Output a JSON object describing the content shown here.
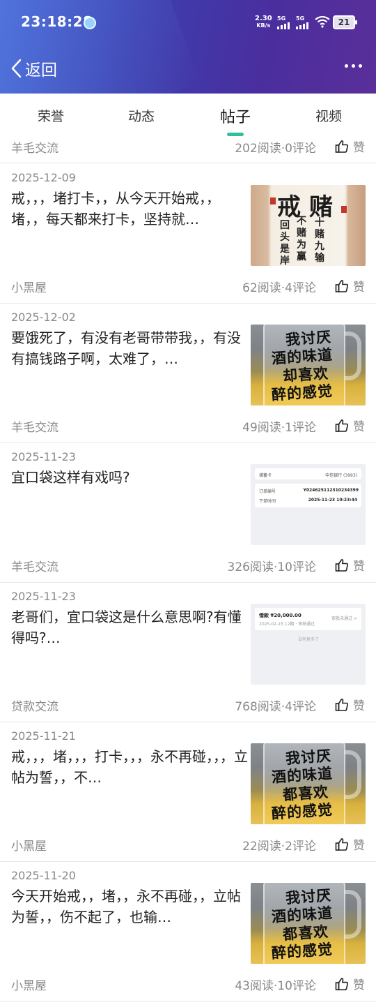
{
  "status_bar": {
    "time": "23:18:28",
    "net_speed_value": "2.30",
    "net_speed_unit": "KB/s",
    "sim1_label": "5G",
    "sim2_label": "5G",
    "battery_level": "21"
  },
  "nav": {
    "back_label": "返回"
  },
  "tabs": [
    {
      "label": "荣誉",
      "active": false
    },
    {
      "label": "动态",
      "active": false
    },
    {
      "label": "帖子",
      "active": true
    },
    {
      "label": "视频",
      "active": false
    }
  ],
  "partial_item": {
    "category": "羊毛交流",
    "stats": "202阅读·0评论",
    "like_label": "赞"
  },
  "posts": [
    {
      "date": "2025-12-09",
      "text": "戒，，，堵打卡，，从今天开始戒，，堵，，每天都来打卡，坚持就…",
      "thumb_type": "calligraphy",
      "thumb_text": {
        "big1": "戒",
        "big2": "赌",
        "col1": "回头是岸",
        "col2": "不赌为赢",
        "col3": "十赌九输"
      },
      "category": "小黑屋",
      "stats": "62阅读·4评论",
      "like_label": "赞"
    },
    {
      "date": "2025-12-02",
      "text": "要饿死了，有没有老哥带带我，，有没有搞钱路子啊，太难了，…",
      "thumb_type": "beer",
      "thumb_text": {
        "l1": "我讨厌",
        "l2": "酒的味道",
        "l3": "却喜欢",
        "l4": "醉的感觉"
      },
      "category": "羊毛交流",
      "stats": "49阅读·1评论",
      "like_label": "赞"
    },
    {
      "date": "2025-11-23",
      "text": "宜口袋这样有戏吗?",
      "thumb_type": "screenshot1",
      "thumb_text": {
        "r1a": "储蓄卡",
        "r1b": "中信银行 (3993)",
        "r2a": "订单编号",
        "r2b": "Y024625112310234399",
        "r3a": "下单时间",
        "r3b": "2025-11-23 10:23:44"
      },
      "category": "羊毛交流",
      "stats": "326阅读·10评论",
      "like_label": "赞"
    },
    {
      "date": "2025-11-23",
      "text": "老哥们，宜口袋这是什么意思啊?有懂得吗?…",
      "thumb_type": "screenshot2",
      "thumb_text": {
        "amount": "借款 ¥20,000.00",
        "sub": "2025-02-15 12期 · 审核通过",
        "link": "审批未通过 >",
        "empty": "没有更多了"
      },
      "category": "贷款交流",
      "stats": "768阅读·4评论",
      "like_label": "赞"
    },
    {
      "date": "2025-11-21",
      "text": "戒，，，堵，，，打卡，，，永不再碰，，，立帖为誓，，不…",
      "thumb_type": "beer",
      "thumb_text": {
        "l1": "我讨厌",
        "l2": "酒的味道",
        "l3": "都喜欢",
        "l4": "醉的感觉"
      },
      "category": "小黑屋",
      "stats": "22阅读·2评论",
      "like_label": "赞"
    },
    {
      "date": "2025-11-20",
      "text": "今天开始戒，，堵，，永不再碰，，立帖为誓，，伤不起了，也输…",
      "thumb_type": "beer",
      "thumb_text": {
        "l1": "我讨厌",
        "l2": "酒的味道",
        "l3": "都喜欢",
        "l4": "醉的感觉"
      },
      "category": "小黑屋",
      "stats": "43阅读·10评论",
      "like_label": "赞"
    }
  ]
}
